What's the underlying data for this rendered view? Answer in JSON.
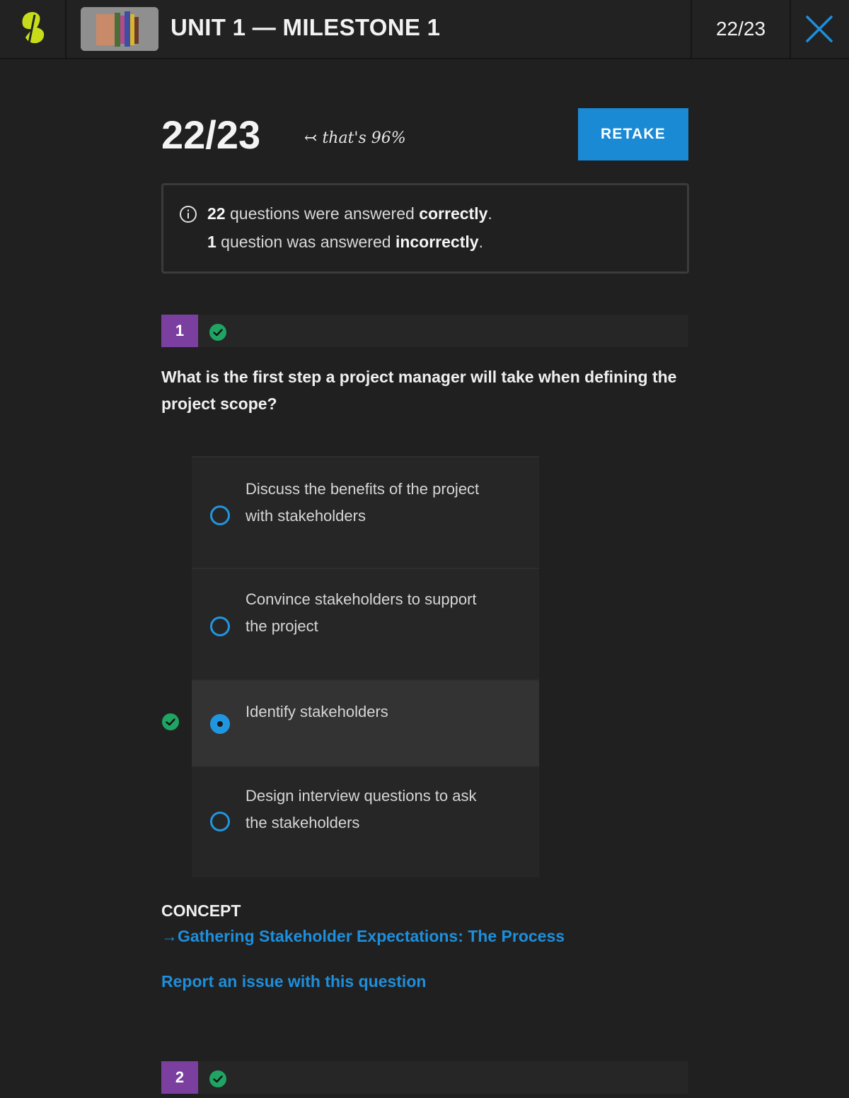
{
  "header": {
    "title": "UNIT 1 — MILESTONE 1",
    "score": "22/23"
  },
  "result": {
    "score": "22/23",
    "note": "that's 96%",
    "retake_label": "RETAKE",
    "correct_count": "22",
    "correct_text": " questions were answered ",
    "correct_word": "correctly",
    "incorrect_count": "1",
    "incorrect_text": " question was answered ",
    "incorrect_word": "incorrectly",
    "period": "."
  },
  "question1": {
    "number": "1",
    "text": "What is the first step a project manager will take when defining the project scope?",
    "options": [
      {
        "line1": "Discuss the benefits of the project",
        "line2": "with stakeholders",
        "selected": false
      },
      {
        "line1": "Convince stakeholders to support",
        "line2": "the project",
        "selected": false
      },
      {
        "line1": "Identify stakeholders",
        "line2": "",
        "selected": true
      },
      {
        "line1": "Design interview questions to ask",
        "line2": "the stakeholders",
        "selected": false
      }
    ],
    "concept_label": "CONCEPT",
    "concept_link": "Gathering Stakeholder Expectations: The Process",
    "report_link": "Report an issue with this question"
  },
  "question2": {
    "number": "2"
  },
  "colors": {
    "accent": "#1a8ad5",
    "badge": "#7b3fa0",
    "correct": "#1fa463",
    "logo": "#c8dd1a"
  }
}
